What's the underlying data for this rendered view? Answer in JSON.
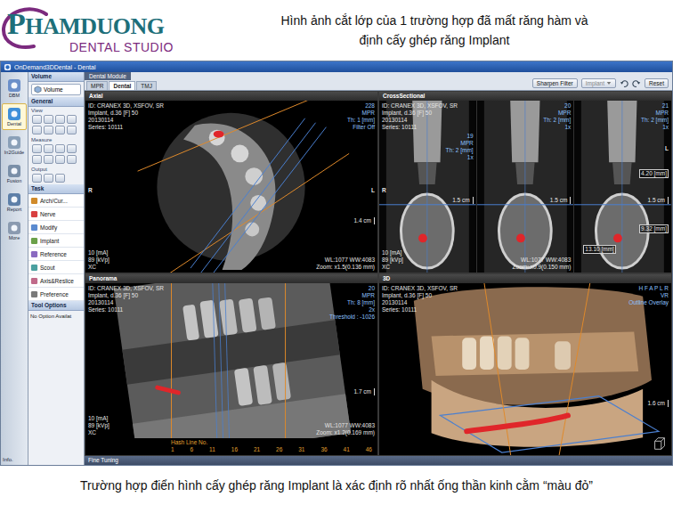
{
  "header": {
    "logo": {
      "name": "PHAMDUONG",
      "sub": "DENTAL STUDIO"
    },
    "title_lines": [
      "Hình ảnh cắt lớp của 1 trường hợp đã mất răng hàm và",
      "định cấy ghép răng Implant"
    ]
  },
  "window": {
    "title": "OnDemand3DDental - Dental"
  },
  "rail": [
    {
      "label": "DBM",
      "selected": false
    },
    {
      "label": "Dental",
      "selected": true
    },
    {
      "label": "In2Guide",
      "selected": false
    },
    {
      "label": "Fusion",
      "selected": false
    },
    {
      "label": "Report",
      "selected": false
    },
    {
      "label": "More",
      "selected": false
    }
  ],
  "info": "Info.",
  "panel": {
    "volume": {
      "title": "Volume",
      "button": "Volume"
    },
    "general": {
      "title": "General",
      "view": "View",
      "measure": "Measure",
      "output": "Output"
    },
    "task": {
      "title": "Task",
      "items": [
        "Arch/Cur...",
        "Nerve",
        "Modify",
        "Implant",
        "Reference",
        "Scout",
        "Axis&Reslice",
        "Preference"
      ]
    },
    "tool_options": {
      "title": "Tool Options",
      "text": "No Option Availat"
    }
  },
  "module": {
    "title": "Dental Module",
    "tabs": [
      {
        "label": "MPR",
        "selected": false
      },
      {
        "label": "Dental",
        "selected": true
      },
      {
        "label": "TMJ",
        "selected": false
      }
    ],
    "filter": "Sharpen Filter",
    "implant": {
      "label": "Implant",
      "disabled": true
    },
    "reset": "Reset"
  },
  "viewports": [
    {
      "title": "Axial",
      "kind": "axial",
      "info": [
        "ID: CRANEX 3D, XSFOV, SR",
        "Implant, d.36 [F] 50",
        "20130114",
        "Series: 10111"
      ],
      "top_right": [
        "228",
        "MPR",
        "Th: 1 [mm]",
        "Filter Off"
      ],
      "side_labels": [
        "R",
        "L"
      ],
      "scale": "1.4 cm",
      "bottom_left": [
        "10 [mA]",
        "89 [kVp]",
        "XC"
      ],
      "bottom_right": [
        "WL:1077 WW:4083",
        "Zoom: x1.5(0.136 mm)"
      ]
    },
    {
      "title": "CrossSectional",
      "kind": "cross",
      "info": [
        "ID: CRANEX 3D, XSFOV, SR",
        "Implant, d.36 [F] 50",
        "20130114",
        "Series: 10111"
      ],
      "panes": [
        {
          "lines": [
            "19",
            "MPR",
            "Th: 2 [mm]",
            "1x"
          ],
          "scale": "1.5 cm"
        },
        {
          "lines": [
            "20",
            "MPR",
            "Th: 2 [mm]",
            "1x"
          ],
          "scale": "1.5 cm"
        },
        {
          "lines": [
            "21",
            "MPR",
            "Th: 2 [mm]",
            "1x"
          ],
          "scale": "1.5 cm"
        }
      ],
      "side_labels": [
        "R",
        "L"
      ],
      "measures": [
        "4.20 [mm]",
        "9.32 [mm]",
        "13.10 [mm]"
      ],
      "bottom_left": [
        "10 [mA]",
        "89 [kVp]",
        "XC"
      ],
      "bottom_right": [
        "WL:1077 WW:4083",
        "Zoom: x0.9(0.150 mm)"
      ]
    },
    {
      "title": "Panorama",
      "kind": "panorama",
      "info": [
        "ID: CRANEX 3D, XSFOV, SR",
        "Implant, d.36 [F] 50",
        "20130114",
        "Series: 10111"
      ],
      "top_right": [
        "20",
        "MPR",
        "Th: 8 [mm]",
        "2x",
        "Threshold : -1026"
      ],
      "side_labels": [],
      "scale": "1.7 cm",
      "bottom_left": [
        "10 [mA]",
        "89 [kVp]",
        "XC"
      ],
      "bottom_right": [
        "WL:1077 WW:4083",
        "Zoom: x1.2(0.169 mm)"
      ],
      "hash": {
        "label": "Hash Line No.",
        "numbers": [
          "1",
          "6",
          "11",
          "16",
          "21",
          "26",
          "31",
          "36",
          "41",
          "46"
        ]
      }
    },
    {
      "title": "3D",
      "kind": "3d",
      "info": [
        "ID: CRANEX 3D, XSFOV, SR",
        "Implant, d.36 [F] 50",
        "20130114",
        "Series: 10111"
      ],
      "top_right": [
        "H F A P L R",
        "VR",
        "Outline Overlay"
      ],
      "side_labels": [],
      "scale": "1.6 cm",
      "bottom_left": [],
      "bottom_right": []
    }
  ],
  "fine_tuning": "Fine Tuning",
  "caption": "Trường hợp điển hình cấy ghép răng Implant là xác định rõ nhất ống thần kinh cằm “màu đỏ”"
}
